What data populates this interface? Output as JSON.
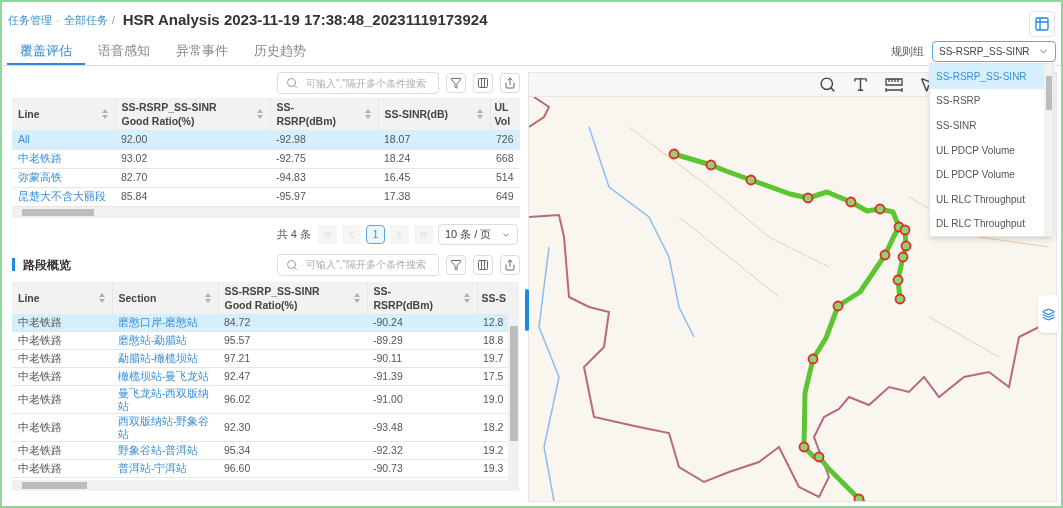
{
  "breadcrumb": [
    {
      "kind": "link",
      "text": "任务管理"
    },
    {
      "kind": "sep",
      "text": "·"
    },
    {
      "kind": "link",
      "text": "全部任务"
    },
    {
      "kind": "sep",
      "text": "/"
    }
  ],
  "title": "HSR Analysis 2023-11-19 17:38:48_20231119173924",
  "tabs": [
    {
      "label": "覆盖评估",
      "selected": true
    },
    {
      "label": "语音感知",
      "selected": false
    },
    {
      "label": "异常事件",
      "selected": false
    },
    {
      "label": "历史趋势",
      "selected": false
    }
  ],
  "rule_group": {
    "label": "规则组",
    "value": "SS-RSRP_SS-SINR",
    "options": [
      {
        "label": "SS-RSRP_SS-SINR",
        "selected": true
      },
      {
        "label": "SS-RSRP",
        "selected": false
      },
      {
        "label": "SS-SINR",
        "selected": false
      },
      {
        "label": "UL PDCP Volume",
        "selected": false
      },
      {
        "label": "DL PDCP Volume",
        "selected": false
      },
      {
        "label": "UL RLC Throughput",
        "selected": false
      },
      {
        "label": "DL RLC Throughput",
        "selected": false
      }
    ]
  },
  "line_table": {
    "search": {
      "placeholder": "可输入\",\"隔开多个条件搜索"
    },
    "columns": [
      "Line",
      "SS-RSRP_SS-SINR Good Ratio(%)",
      "SS-RSRP(dBm)",
      "SS-SINR(dB)",
      "UL Vol"
    ],
    "rows": [
      {
        "selected": true,
        "cells": [
          "All",
          "92.00",
          "-92.98",
          "18.07",
          "726"
        ]
      },
      {
        "selected": false,
        "cells": [
          "中老铁路",
          "93.02",
          "-92.75",
          "18.24",
          "668"
        ]
      },
      {
        "selected": false,
        "cells": [
          "弥蒙高铁",
          "82.70",
          "-94.83",
          "16.45",
          "514"
        ]
      },
      {
        "selected": false,
        "cells": [
          "昆楚大不含大丽段",
          "85.84",
          "-95.97",
          "17.38",
          "649"
        ]
      }
    ],
    "pagination": {
      "total": "共 4 条",
      "pages": [
        {
          "label": "1",
          "selected": true
        }
      ],
      "page_size": "10 条 / 页"
    }
  },
  "section_table": {
    "title": "路段概览",
    "search": {
      "placeholder": "可输入\",\"隔开多个条件搜索"
    },
    "columns": [
      "Line",
      "Section",
      "SS-RSRP_SS-SINR Good Ratio(%)",
      "SS-RSRP(dBm)",
      "SS-S"
    ],
    "rows": [
      {
        "selected": true,
        "cells": [
          "中老铁路",
          "磨憨口岸-磨憨站",
          "84.72",
          "-90.24",
          "12.8"
        ]
      },
      {
        "selected": false,
        "cells": [
          "中老铁路",
          "磨憨站-勐腊站",
          "95.57",
          "-89.29",
          "18.8"
        ]
      },
      {
        "selected": false,
        "cells": [
          "中老铁路",
          "勐腊站-橄榄坝站",
          "97.21",
          "-90.11",
          "19.7"
        ]
      },
      {
        "selected": false,
        "cells": [
          "中老铁路",
          "橄榄坝站-曼飞龙站",
          "92.47",
          "-91.39",
          "17.5"
        ]
      },
      {
        "selected": false,
        "cells": [
          "中老铁路",
          "曼飞龙站-西双版纳站",
          "96.02",
          "-91.00",
          "19.0"
        ]
      },
      {
        "selected": false,
        "cells": [
          "中老铁路",
          "西双版纳站-野象谷站",
          "92.30",
          "-93.48",
          "18.2"
        ]
      },
      {
        "selected": false,
        "cells": [
          "中老铁路",
          "野象谷站-普洱站",
          "95.34",
          "-92.32",
          "19.2"
        ]
      },
      {
        "selected": false,
        "cells": [
          "中老铁路",
          "普洱站-宁洱站",
          "96.60",
          "-90.73",
          "19.3"
        ]
      }
    ]
  }
}
